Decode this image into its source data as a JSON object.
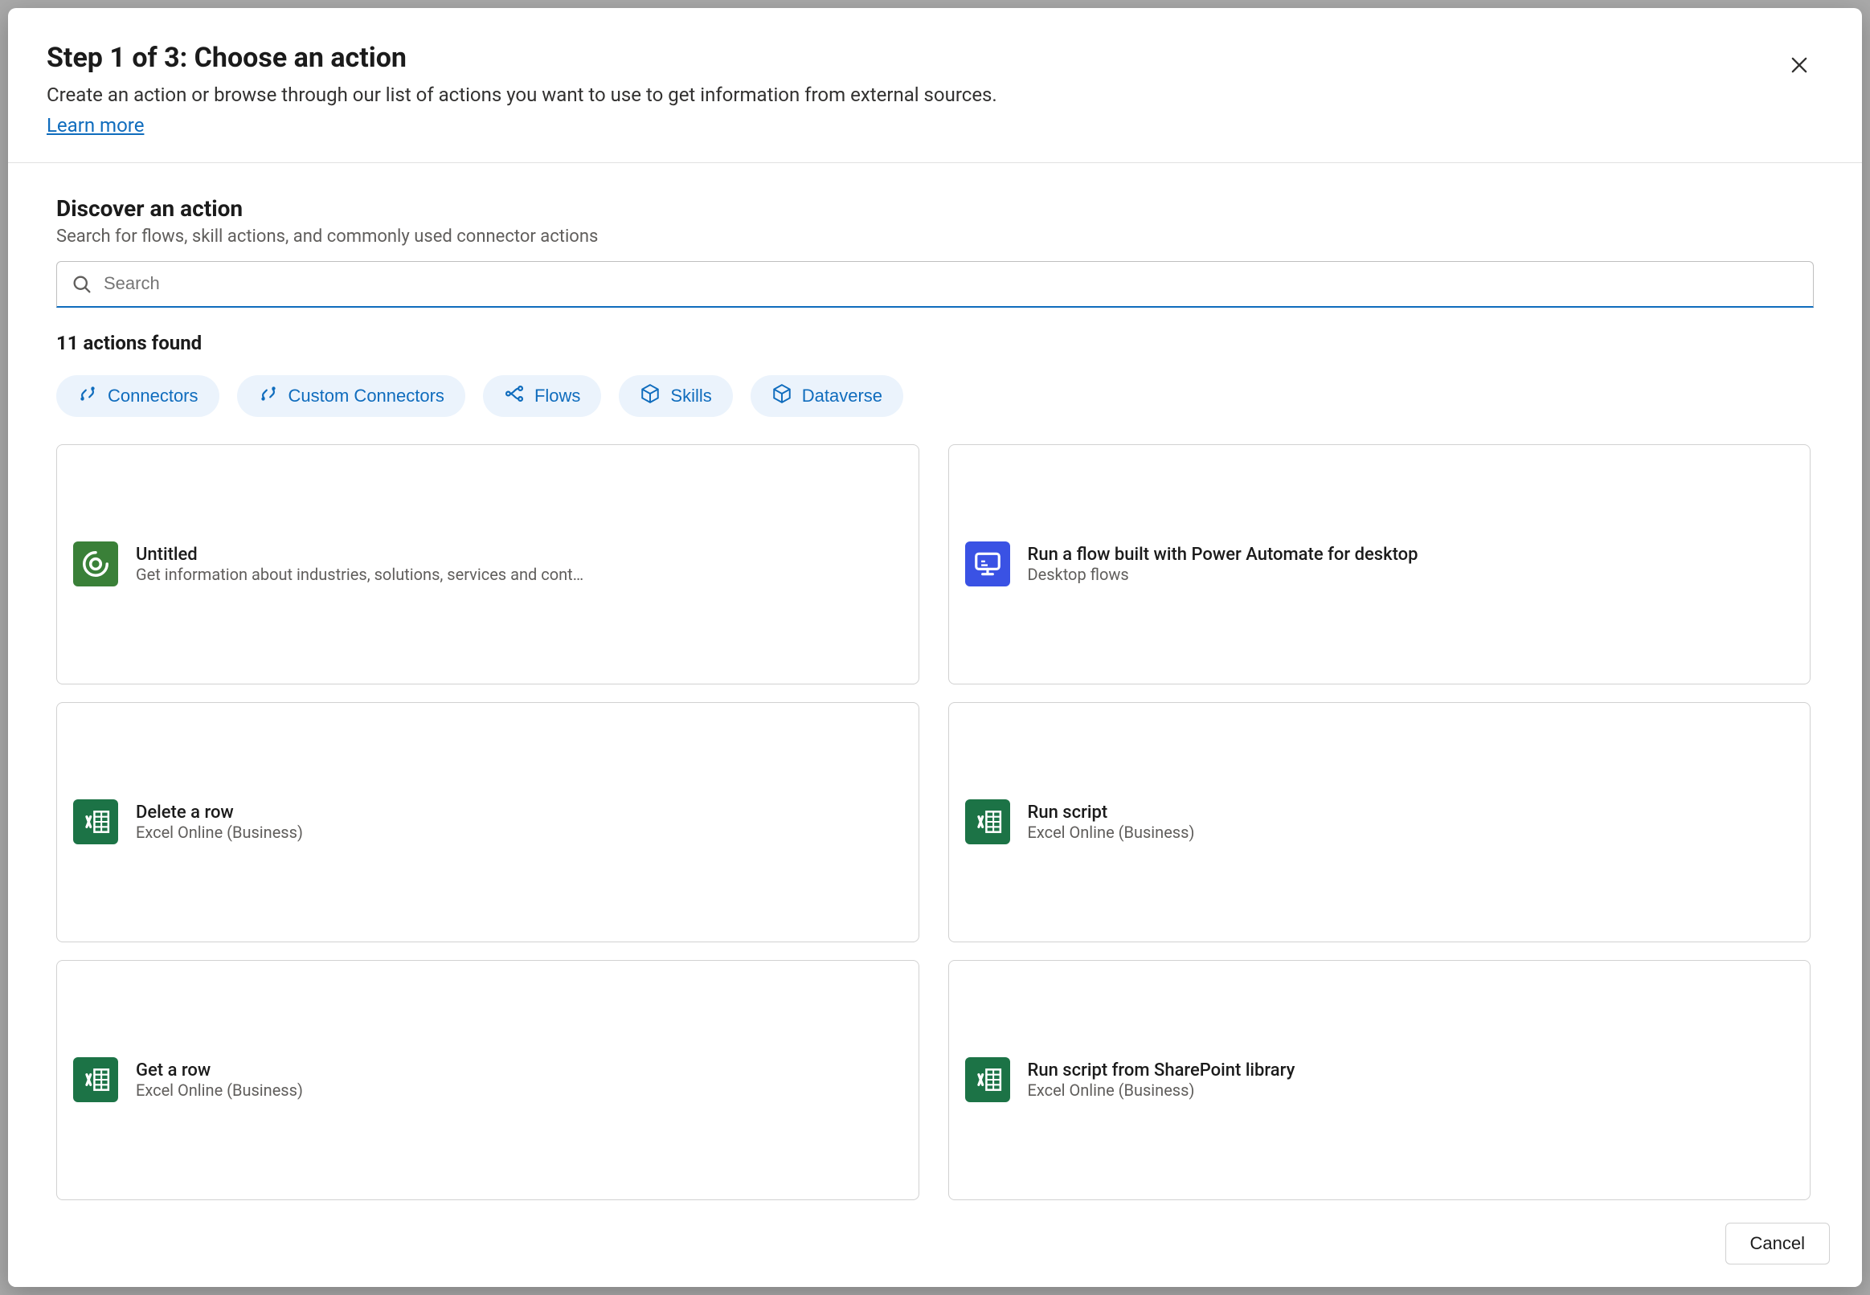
{
  "header": {
    "title": "Step 1 of 3: Choose an action",
    "subtitle": "Create an action or browse through our list of actions you want to use to get information from external sources.",
    "learn_more": "Learn more"
  },
  "discover": {
    "title": "Discover an action",
    "subtitle": "Search for flows, skill actions, and commonly used connector actions",
    "search_placeholder": "Search",
    "results_label": "11 actions found"
  },
  "filters": {
    "connectors": "Connectors",
    "custom_connectors": "Custom Connectors",
    "flows": "Flows",
    "skills": "Skills",
    "dataverse": "Dataverse"
  },
  "cards": {
    "untitled": {
      "title": "Untitled",
      "subtitle": "Get information about industries, solutions, services and cont…",
      "color": "#3a8038"
    },
    "run_pad_flow": {
      "title": "Run a flow built with Power Automate for desktop",
      "subtitle": "Desktop flows",
      "color": "#3a52e4"
    },
    "delete_row": {
      "title": "Delete a row",
      "subtitle": "Excel Online (Business)",
      "color": "#1c7346"
    },
    "run_script": {
      "title": "Run script",
      "subtitle": "Excel Online (Business)",
      "color": "#1c7346"
    },
    "get_row": {
      "title": "Get a row",
      "subtitle": "Excel Online (Business)",
      "color": "#1c7346"
    },
    "run_script_sp": {
      "title": "Run script from SharePoint library",
      "subtitle": "Excel Online (Business)",
      "color": "#1c7346"
    }
  },
  "footer": {
    "cancel": "Cancel"
  }
}
